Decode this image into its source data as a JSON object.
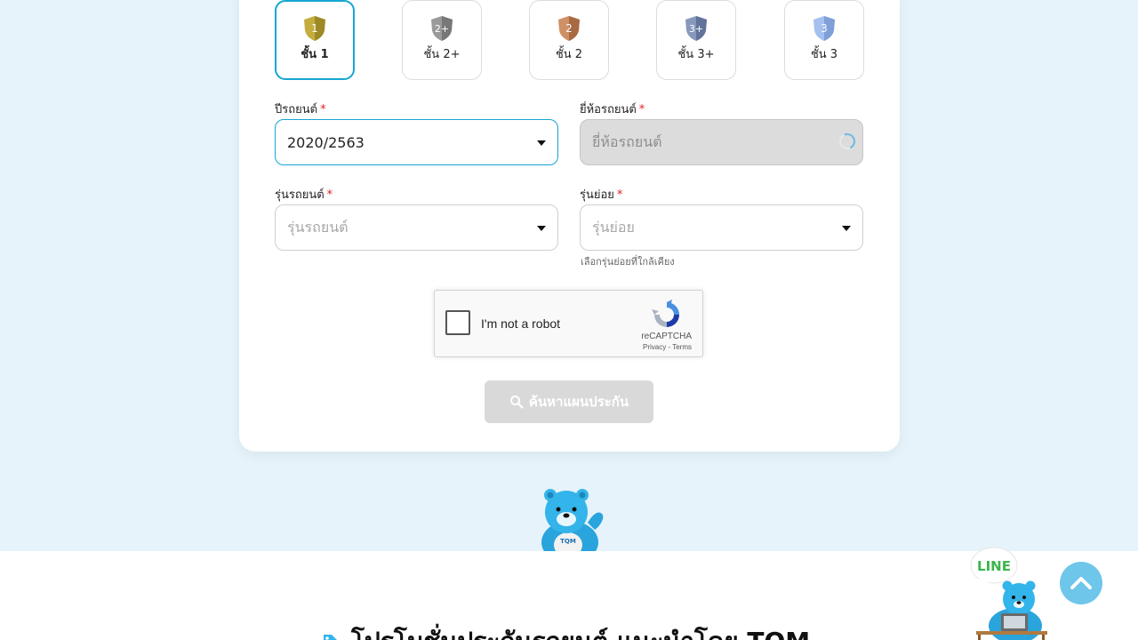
{
  "tiers": [
    {
      "num": "1",
      "label": "ชั้น 1",
      "active": true,
      "color": "#b9a23a"
    },
    {
      "num": "2+",
      "label": "ชั้น 2+",
      "active": false,
      "color": "#8f8f8f"
    },
    {
      "num": "2",
      "label": "ชั้น 2",
      "active": false,
      "color": "#c0825a"
    },
    {
      "num": "3+",
      "label": "ชั้น 3+",
      "active": false,
      "color": "#7a8db2"
    },
    {
      "num": "3",
      "label": "ชั้น 3",
      "active": false,
      "color": "#8fb0e6"
    }
  ],
  "form": {
    "year": {
      "label": "ปีรถยนต์",
      "required": "*",
      "value": "2020/2563"
    },
    "brand": {
      "label": "ยี่ห้อรถยนต์",
      "required": "*",
      "placeholder": "ยี่ห้อรถยนต์"
    },
    "model": {
      "label": "รุ่นรถยนต์",
      "required": "*",
      "placeholder": "รุ่นรถยนต์"
    },
    "submodel": {
      "label": "รุ่นย่อย",
      "required": "*",
      "placeholder": "รุ่นย่อย",
      "hint": "เลือกรุ่นย่อยที่ใกล้เคียง"
    }
  },
  "recaptcha": {
    "text": "I'm not a robot",
    "brand": "reCAPTCHA",
    "links": "Privacy - Terms"
  },
  "search_button": {
    "label": "ค้นหาแผนประกัน"
  },
  "promo": {
    "title": "โปรโมชั่นประกันรถยนต์ แนะนำโดย TQM"
  },
  "line": {
    "label": "LINE",
    "brand": "TQM"
  },
  "colors": {
    "accent": "#14a6d4",
    "background": "#e6f3fb",
    "scroll_top": "#6ec6ea",
    "line_green": "#3bb54a"
  }
}
